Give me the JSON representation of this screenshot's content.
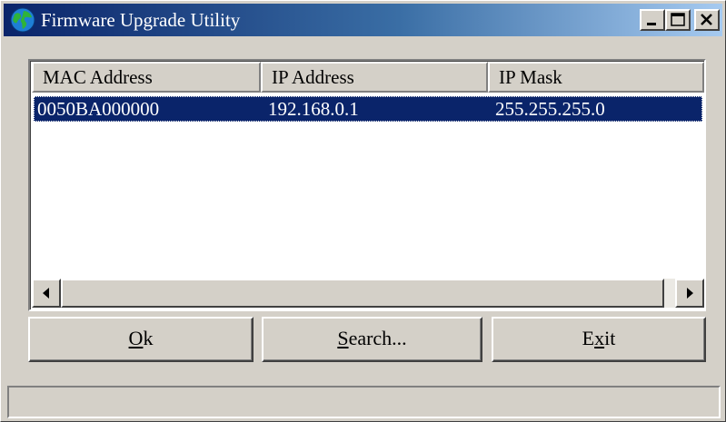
{
  "window": {
    "title": "Firmware Upgrade Utility",
    "app_icon": "globe-icon",
    "controls": {
      "minimize_icon": "minimize-icon",
      "maximize_icon": "maximize-icon",
      "close_icon": "close-icon"
    }
  },
  "table": {
    "columns": [
      "MAC Address",
      "IP Address",
      "IP Mask"
    ],
    "rows": [
      {
        "mac": "0050BA000000",
        "ip": "192.168.0.1",
        "mask": "255.255.255.0",
        "selected": true
      }
    ]
  },
  "buttons": {
    "ok": {
      "accel": "O",
      "rest": "k"
    },
    "search": {
      "accel": "S",
      "rest": "earch..."
    },
    "exit": {
      "pre": "E",
      "accel": "x",
      "rest": "it"
    }
  },
  "statusbar": {
    "text": ""
  },
  "colors": {
    "face": "#d4d0c8",
    "title_active": "#0a246a",
    "selection": "#0a246a"
  }
}
